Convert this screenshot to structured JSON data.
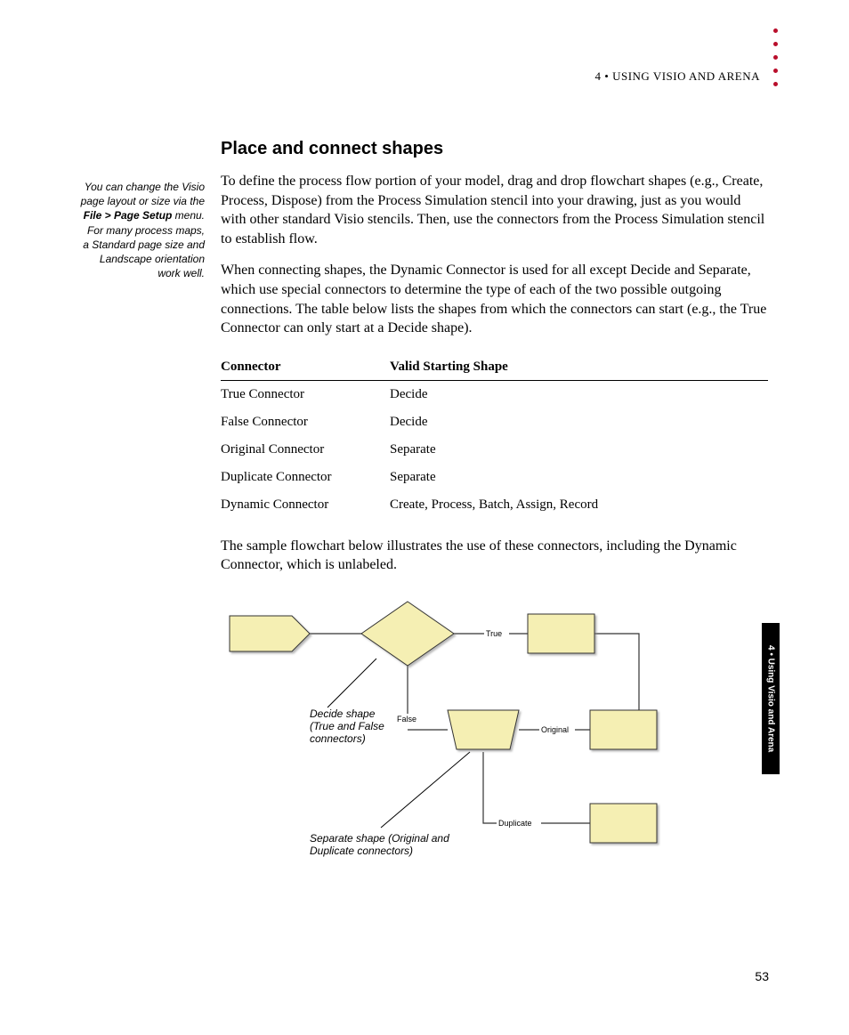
{
  "running_head": "4 • USING VISIO AND ARENA",
  "side_note": {
    "l1": "You can change the Visio page layout or size via the ",
    "b1": "File > Page Setup",
    "l2": " menu. For many process maps, a Standard page size and Landscape orientation work well."
  },
  "section_title": "Place and connect shapes",
  "para1": "To define the process flow portion of your model, drag and drop flowchart shapes (e.g., Create, Process, Dispose) from the Process Simulation stencil into your drawing, just as you would with other standard Visio stencils. Then, use the connectors from the Process Simulation stencil to establish flow.",
  "para2": "When connecting shapes, the Dynamic Connector is used for all except Decide and Separate, which use special connectors to determine the type of each of the two possible outgoing connections. The table below lists the shapes from which the connectors can start (e.g., the True Connector can only start at a Decide shape).",
  "table": {
    "h1": "Connector",
    "h2": "Valid Starting Shape",
    "rows": [
      {
        "c": "True Connector",
        "s": "Decide"
      },
      {
        "c": "False Connector",
        "s": "Decide"
      },
      {
        "c": "Original Connector",
        "s": "Separate"
      },
      {
        "c": "Duplicate Connector",
        "s": "Separate"
      },
      {
        "c": "Dynamic Connector",
        "s": "Create, Process, Batch, Assign, Record"
      }
    ]
  },
  "para3": "The sample flowchart below illustrates the use of these connectors, including the Dynamic Connector, which is unlabeled.",
  "diagram": {
    "true_label": "True",
    "false_label": "False",
    "original_label": "Original",
    "duplicate_label": "Duplicate",
    "callout1": "Decide shape (True and False connectors)",
    "callout2": "Separate shape (Original and Duplicate connectors)"
  },
  "side_tab": "4 • Using Visio and Arena",
  "page_number": "53"
}
